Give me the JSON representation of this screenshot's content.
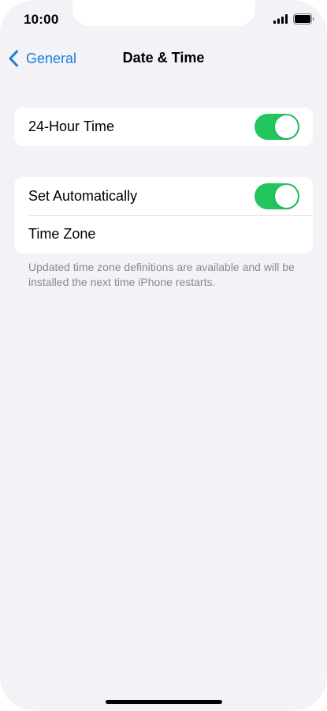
{
  "status_bar": {
    "time": "10:00"
  },
  "nav": {
    "back_label": "General",
    "title": "Date & Time"
  },
  "settings": {
    "hour24": {
      "label": "24-Hour Time",
      "enabled": true
    },
    "set_automatically": {
      "label": "Set Automatically",
      "enabled": true
    },
    "time_zone": {
      "label": "Time Zone"
    }
  },
  "footer_note": "Updated time zone definitions are available and will be installed the next time iPhone restarts.",
  "colors": {
    "accent": "#1a7fd9",
    "toggle_on": "#22c55e",
    "background": "#f2f2f7"
  },
  "icons": {
    "back": "chevron-left-icon",
    "signal": "cellular-signal-icon",
    "battery": "battery-icon"
  }
}
